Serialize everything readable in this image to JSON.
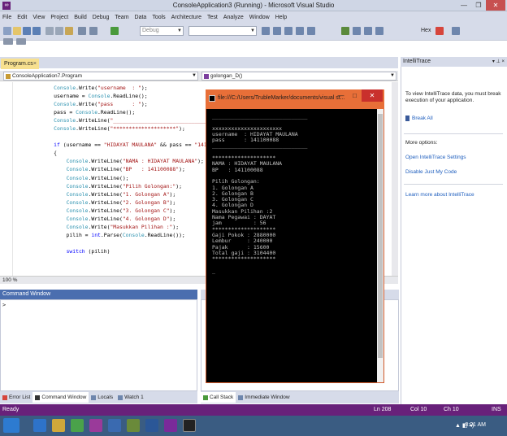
{
  "window": {
    "title": "ConsoleApplication3 (Running) - Microsoft Visual Studio"
  },
  "menu": [
    "File",
    "Edit",
    "View",
    "Project",
    "Build",
    "Debug",
    "Team",
    "Data",
    "Tools",
    "Architecture",
    "Test",
    "Analyze",
    "Window",
    "Help"
  ],
  "toolbar": {
    "config": "Debug",
    "hex_label": "Hex"
  },
  "editor": {
    "tab_label": "Program.cs",
    "nav_left": "ConsoleApplication7.Program",
    "nav_right": "golongan_D()",
    "zoom": "100 %",
    "code": [
      "            Console.Write(\"username  : \");",
      "            username = Console.ReadLine();",
      "            Console.Write(\"pass      : \");",
      "            pass = Console.ReadLine();",
      "            Console.WriteLine(\"______________________________\");",
      "            Console.WriteLine(\"********************\");",
      "",
      "            if (username == \"HIDAYAT MAULANA\" && pass == \"141100088\")",
      "            {",
      "                Console.WriteLine(\"NAMA : HIDAYAT MAULANA\");",
      "                Console.WriteLine(\"BP   : 141100088\");",
      "                Console.WriteLine();",
      "                Console.WriteLine(\"Pilih Golongan:\");",
      "                Console.WriteLine(\"1. Golongan A\");",
      "                Console.WriteLine(\"2. Golongan B\");",
      "                Console.WriteLine(\"3. Golongan C\");",
      "                Console.WriteLine(\"4. Golongan D\");",
      "                Console.Write(\"Masukkan Pilihan :\");",
      "                pilih = int.Parse(Console.ReadLine());",
      "",
      "                switch (pilih)"
    ]
  },
  "console": {
    "title": "file:///C:/Users/TrubleMarker/documents/visual st...",
    "lines": [
      "______________________________",
      "",
      "xxxxxxxxxxxxxxxxxxxxxx",
      "username  : HIDAYAT MAULANA",
      "pass      : 141100088",
      "______________________________",
      "",
      "********************",
      "NAMA : HIDAYAT MAULANA",
      "BP   : 141100088",
      "",
      "Pilih Golongan:",
      "1. Golongan A",
      "2. Golongan B",
      "3. Golongan C",
      "4. Golongan D",
      "Masukkan Pilihan :2",
      "Nama Pegawai : DAYAT",
      "jam          : 56",
      "********************",
      "Gaji Pokok : 2880000",
      "Lembur     : 240000",
      "Pajak      : 15600",
      "Total gaji : 3104400",
      "********************",
      "",
      "_"
    ]
  },
  "intellitrace": {
    "title": "IntelliTrace",
    "intro": "To view IntelliTrace data, you must break execution of your application.",
    "break_all": "Break All",
    "more_options": "More options:",
    "open_settings": "Open IntelliTrace Settings",
    "disable_jmc": "Disable Just My Code",
    "learn_more": "Learn more about IntelliTrace"
  },
  "panels": {
    "command_window_title": "Command Window",
    "prompt": ">",
    "left_tabs": [
      "Error List",
      "Command Window",
      "Locals",
      "Watch 1"
    ],
    "right_tabs": [
      "Call Stack",
      "Immediate Window"
    ]
  },
  "statusbar": {
    "ready": "Ready",
    "ln": "Ln 208",
    "col": "Col 10",
    "ch": "Ch 10",
    "ins": "INS"
  },
  "taskbar": {
    "clock": "8:01 AM"
  },
  "colors": {
    "accent": "#68217a",
    "console_title": "#e86f38",
    "link": "#1e5ebe"
  }
}
